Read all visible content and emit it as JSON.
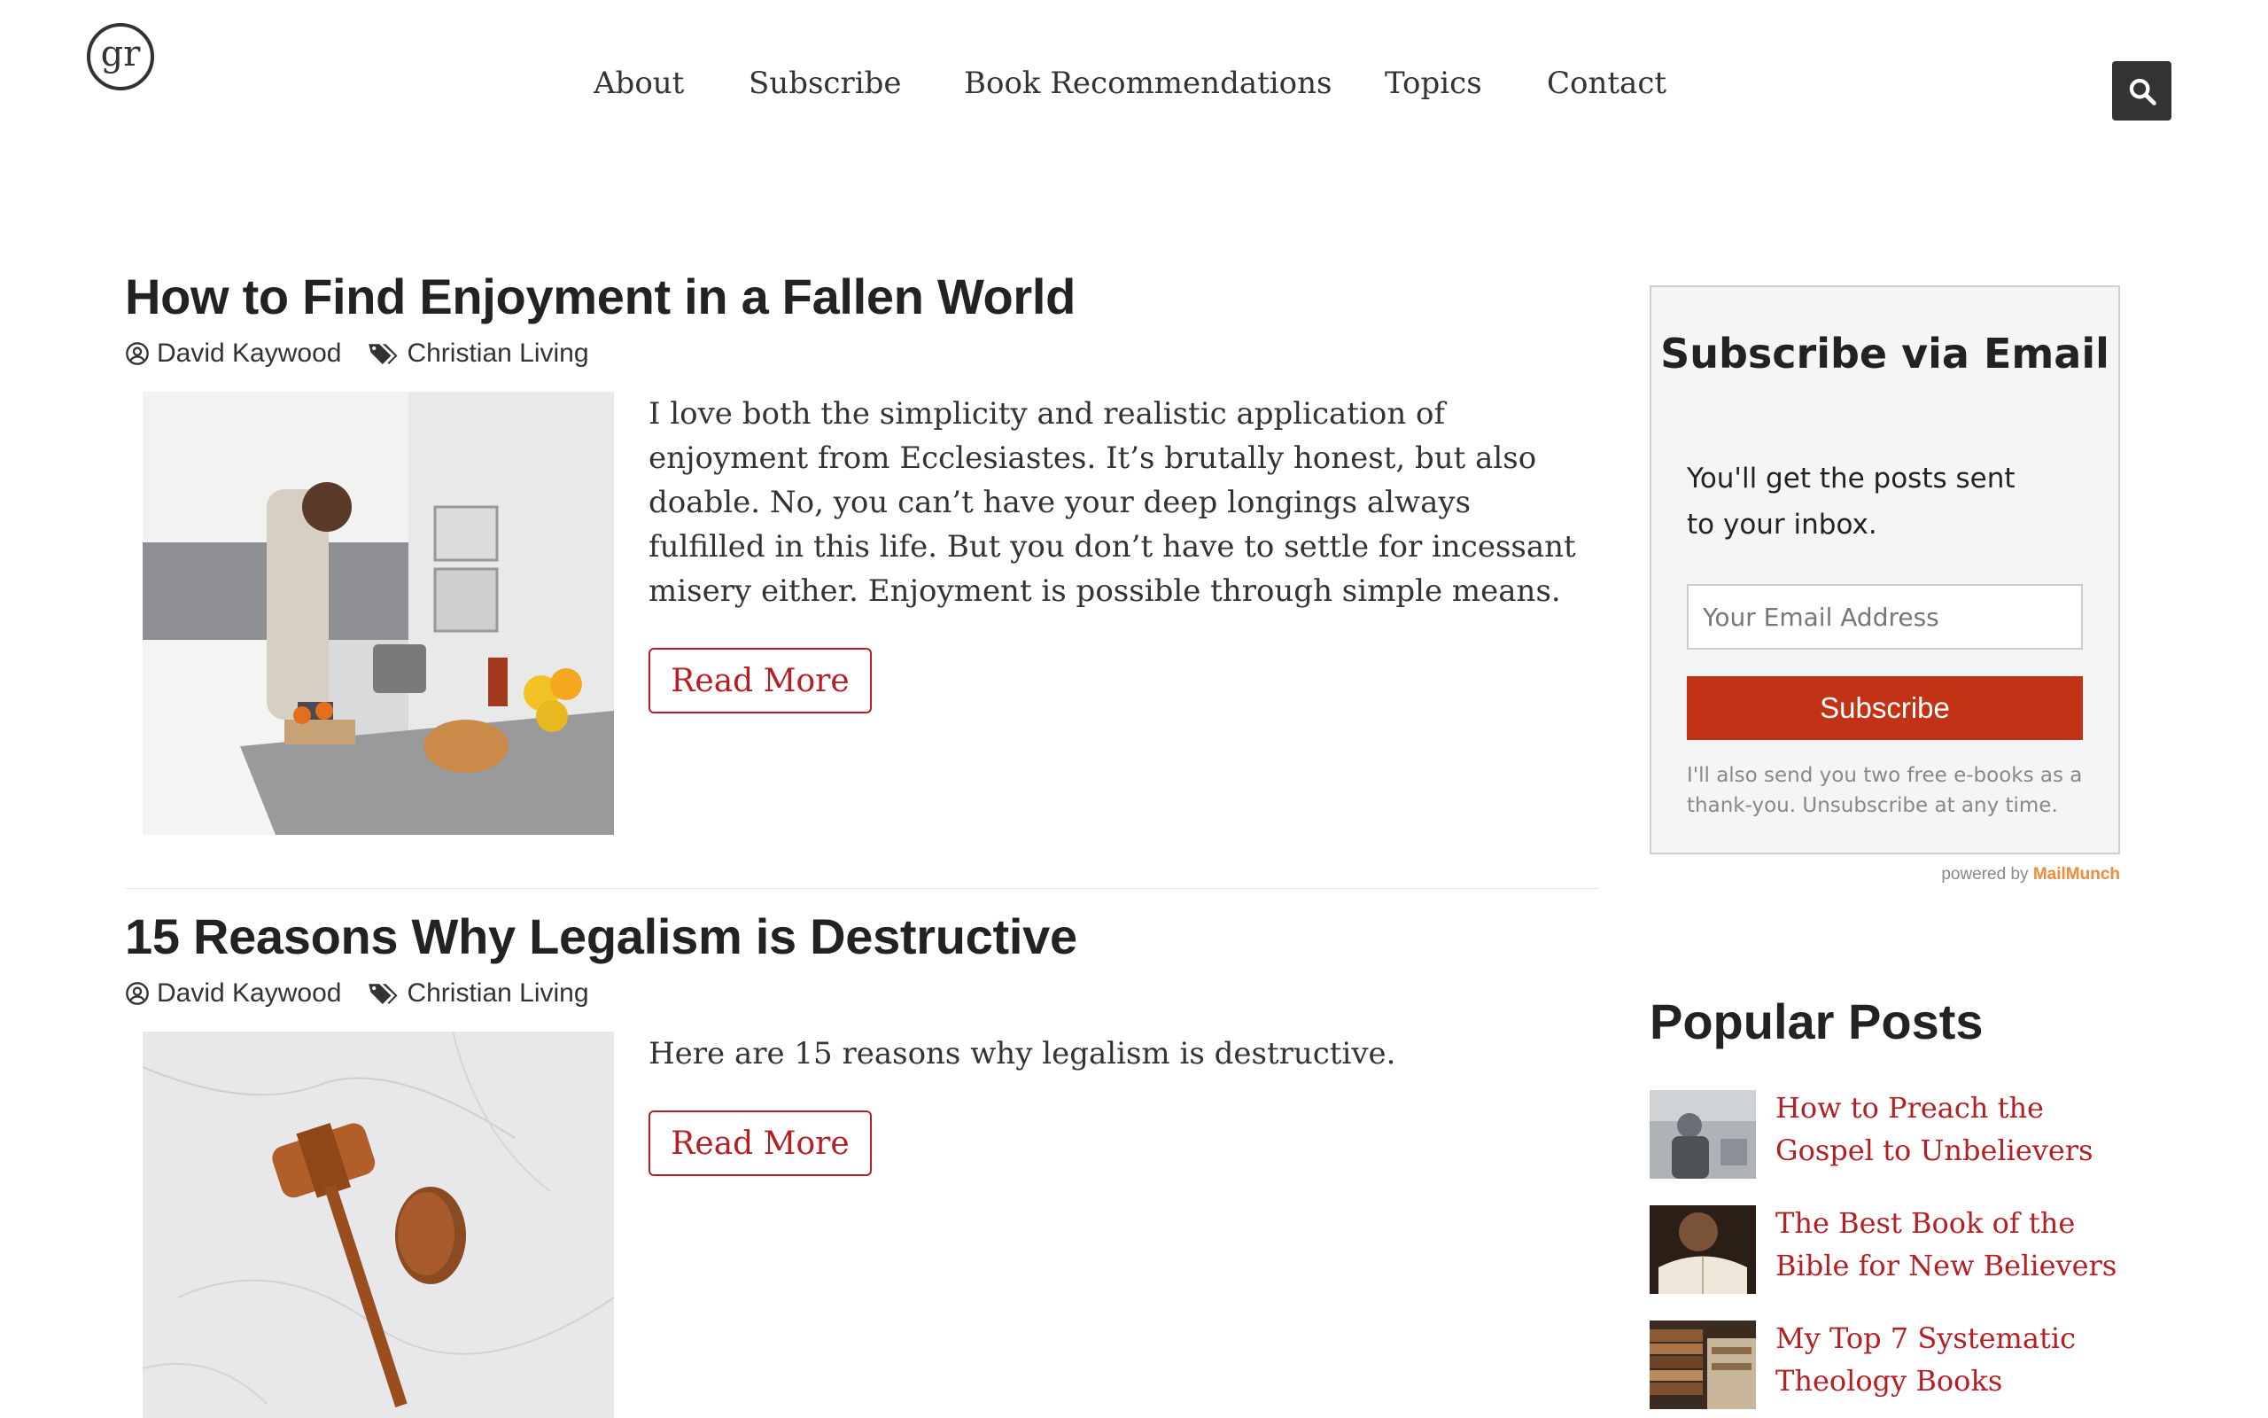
{
  "site": {
    "logo_text": "gr"
  },
  "nav": {
    "items": [
      {
        "label": "About"
      },
      {
        "label": "Subscribe"
      },
      {
        "label": "Book Recommendations"
      },
      {
        "label": "Topics"
      },
      {
        "label": "Contact"
      }
    ]
  },
  "posts": [
    {
      "title": "How to Find Enjoyment in a Fallen World",
      "author": "David Kaywood",
      "category": "Christian Living",
      "excerpt": "I love both the simplicity and realistic application of enjoyment from Ecclesiastes. It’s brutally honest, but also doable. No, you can’t have your deep longings always fulfilled in this life. But you don’t have to settle for incessant misery either. Enjoyment is possible through simple means.",
      "read_more": "Read More"
    },
    {
      "title": "15 Reasons Why Legalism is Destructive",
      "author": "David Kaywood",
      "category": "Christian Living",
      "excerpt": "Here are 15 reasons why legalism is destructive.",
      "read_more": "Read More"
    }
  ],
  "subscribe": {
    "title": "Subscribe via Email",
    "description": "You'll get the posts sent to your inbox.",
    "email_placeholder": "Your Email Address",
    "button_label": "Subscribe",
    "note": "I'll also send you two free e-books as a thank-you. Unsubscribe at any time.",
    "powered_by": "powered by",
    "powered_brand": "MailMunch"
  },
  "popular": {
    "heading": "Popular Posts",
    "items": [
      {
        "title": "How to Preach the Gospel to Unbelievers"
      },
      {
        "title": "The Best Book of the Bible for New Believers"
      },
      {
        "title": "My Top 7 Systematic Theology Books"
      }
    ]
  },
  "colors": {
    "accent": "#b41f24",
    "subscribe_button": "#c23315",
    "brand_orange": "#f08a3c"
  },
  "icons": {
    "search": "search-icon",
    "author": "user-circle-icon",
    "category": "tags-icon"
  }
}
